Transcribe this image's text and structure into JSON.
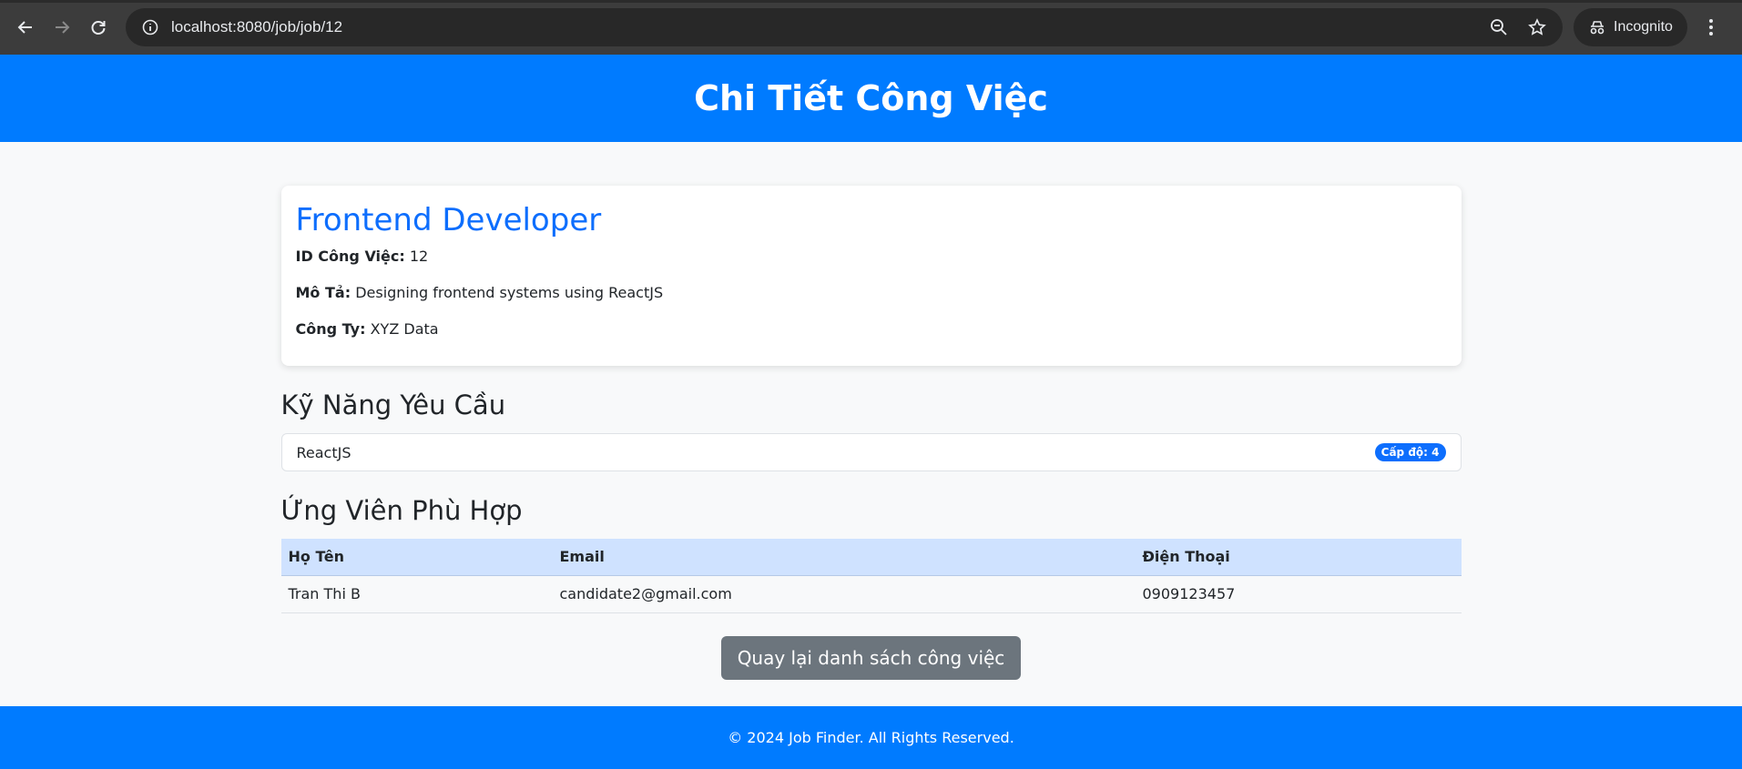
{
  "browser": {
    "url": "localhost:8080/job/job/12",
    "incognito_label": "Incognito"
  },
  "header": {
    "title": "Chi Tiết Công Việc"
  },
  "job": {
    "title": "Frontend Developer",
    "id_label": "ID Công Việc:",
    "id_value": "12",
    "desc_label": "Mô Tả:",
    "desc_value": "Designing frontend systems using ReactJS",
    "company_label": "Công Ty:",
    "company_value": "XYZ Data"
  },
  "skills": {
    "title": "Kỹ Năng Yêu Cầu",
    "items": [
      {
        "name": "ReactJS",
        "level": "Cấp độ: 4"
      }
    ]
  },
  "candidates": {
    "title": "Ứng Viên Phù Hợp",
    "headers": [
      "Họ Tên",
      "Email",
      "Điện Thoại"
    ],
    "rows": [
      {
        "name": "Tran Thi B",
        "email": "candidate2@gmail.com",
        "phone": "0909123457"
      }
    ]
  },
  "back_button": "Quay lại danh sách công việc",
  "footer": "© 2024 Job Finder. All Rights Reserved."
}
